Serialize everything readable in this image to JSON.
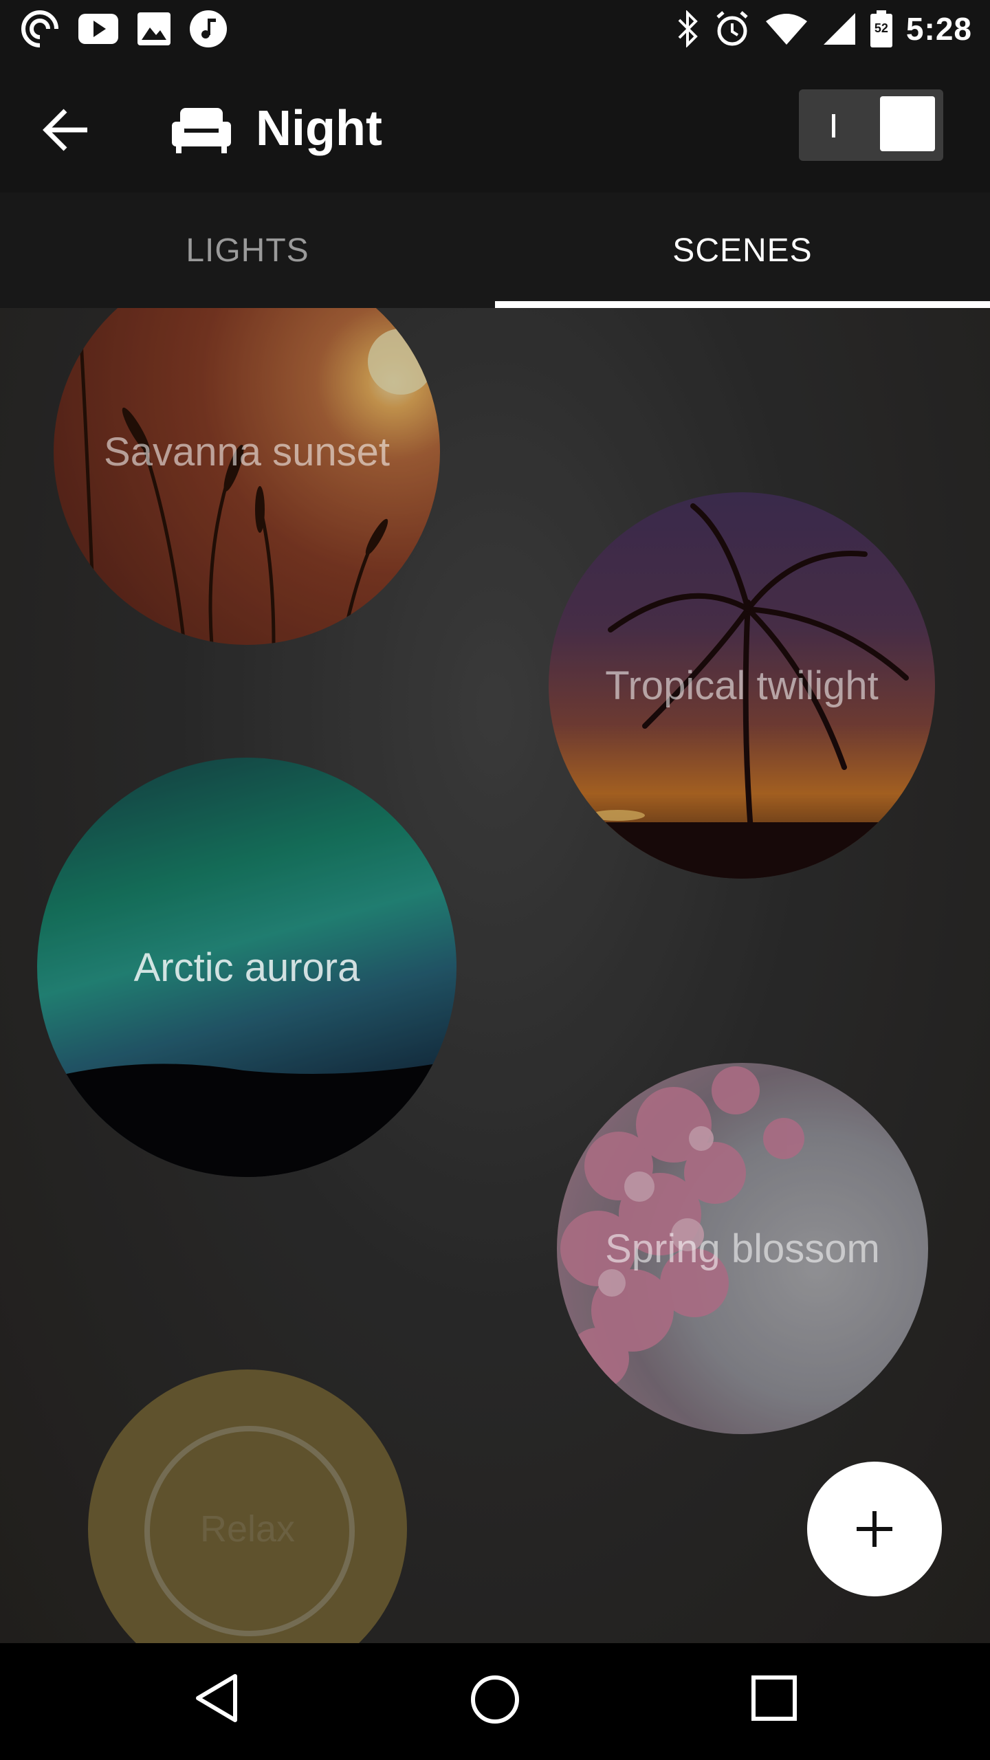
{
  "status_bar": {
    "time": "5:28",
    "battery_level": "52",
    "left_icons": [
      "pocket-casts-icon",
      "youtube-icon",
      "image-icon",
      "music-icon"
    ],
    "right_icons": [
      "bluetooth-icon",
      "alarm-icon",
      "wifi-icon",
      "cell-signal-icon",
      "battery-icon"
    ]
  },
  "app_bar": {
    "title": "Night",
    "room_icon": "sofa-icon",
    "toggle_state": "on"
  },
  "tabs": [
    {
      "label": "LIGHTS",
      "selected": false
    },
    {
      "label": "SCENES",
      "selected": true
    }
  ],
  "scenes": [
    {
      "label": "Savanna sunset"
    },
    {
      "label": "Tropical twilight"
    },
    {
      "label": "Arctic aurora"
    },
    {
      "label": "Spring blossom"
    },
    {
      "label": "Relax"
    }
  ],
  "fab": {
    "icon": "plus-icon"
  },
  "nav_bar": {
    "buttons": [
      "back-icon",
      "home-icon",
      "recents-icon"
    ]
  },
  "colors": {
    "background": "#121212",
    "tab_indicator": "#ffffff",
    "fab": "#ffffff"
  }
}
